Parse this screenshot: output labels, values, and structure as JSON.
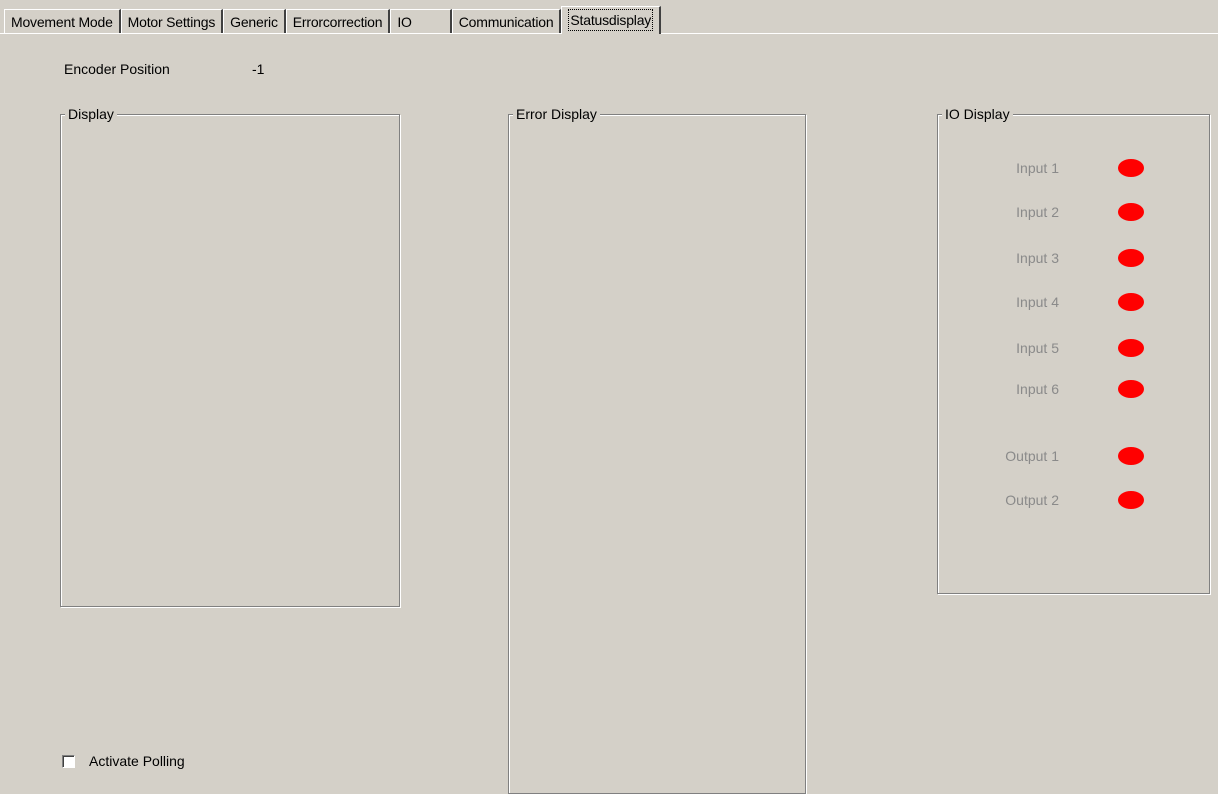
{
  "tabs": [
    {
      "label": "Movement Mode"
    },
    {
      "label": "Motor Settings"
    },
    {
      "label": "Generic"
    },
    {
      "label": "Errorcorrection"
    },
    {
      "label": "IO"
    },
    {
      "label": "Communication"
    },
    {
      "label": "Statusdisplay",
      "active": true
    }
  ],
  "encoder": {
    "label": "Encoder Position",
    "value": "-1"
  },
  "display_group": {
    "title": "Display"
  },
  "error_group": {
    "title": "Error Display"
  },
  "io_group": {
    "title": "IO Display",
    "rows": [
      {
        "label": "Input 1",
        "state": "off"
      },
      {
        "label": "Input 2",
        "state": "off"
      },
      {
        "label": "Input 3",
        "state": "off"
      },
      {
        "label": "Input 4",
        "state": "off"
      },
      {
        "label": "Input 5",
        "state": "off"
      },
      {
        "label": "Input 6",
        "state": "off"
      },
      {
        "label": "Output 1",
        "state": "off"
      },
      {
        "label": "Output 2",
        "state": "off"
      }
    ],
    "led_color": "#ff0000",
    "label_color": "#8a8a8a"
  },
  "polling": {
    "label": "Activate Polling",
    "checked": false
  },
  "colors": {
    "background": "#d4d0c8"
  }
}
